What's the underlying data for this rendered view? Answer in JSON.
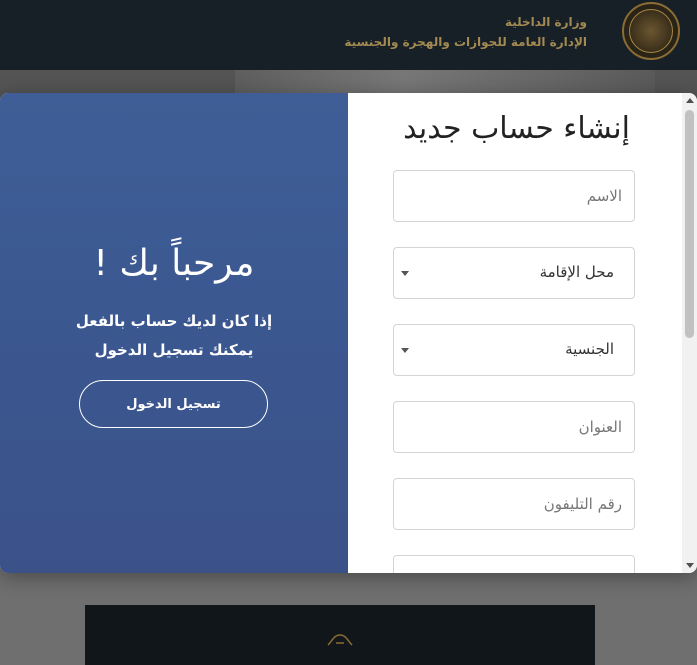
{
  "header": {
    "ministry_line1": "وزارة الداخلية",
    "ministry_line2": "الإدارة العامة للجوازات والهجرة والجنسية",
    "logo_icon": "eagle-emblem-icon"
  },
  "welcome": {
    "title": "مرحباً بك !",
    "text": "إذا كان لديك حساب بالفعل يمكنك تسجيل الدخول",
    "login_label": "تسجيل الدخول"
  },
  "form": {
    "title": "إنشاء حساب جديد",
    "name_placeholder": "الاسم",
    "residence_value": "محل الإقامة",
    "nationality_value": "الجنسية",
    "address_placeholder": "العنوان",
    "phone_placeholder": "رقم التليفون"
  },
  "colors": {
    "panel_blue": "#3d5993",
    "header_dark": "#172027",
    "gold": "#a28a52"
  }
}
